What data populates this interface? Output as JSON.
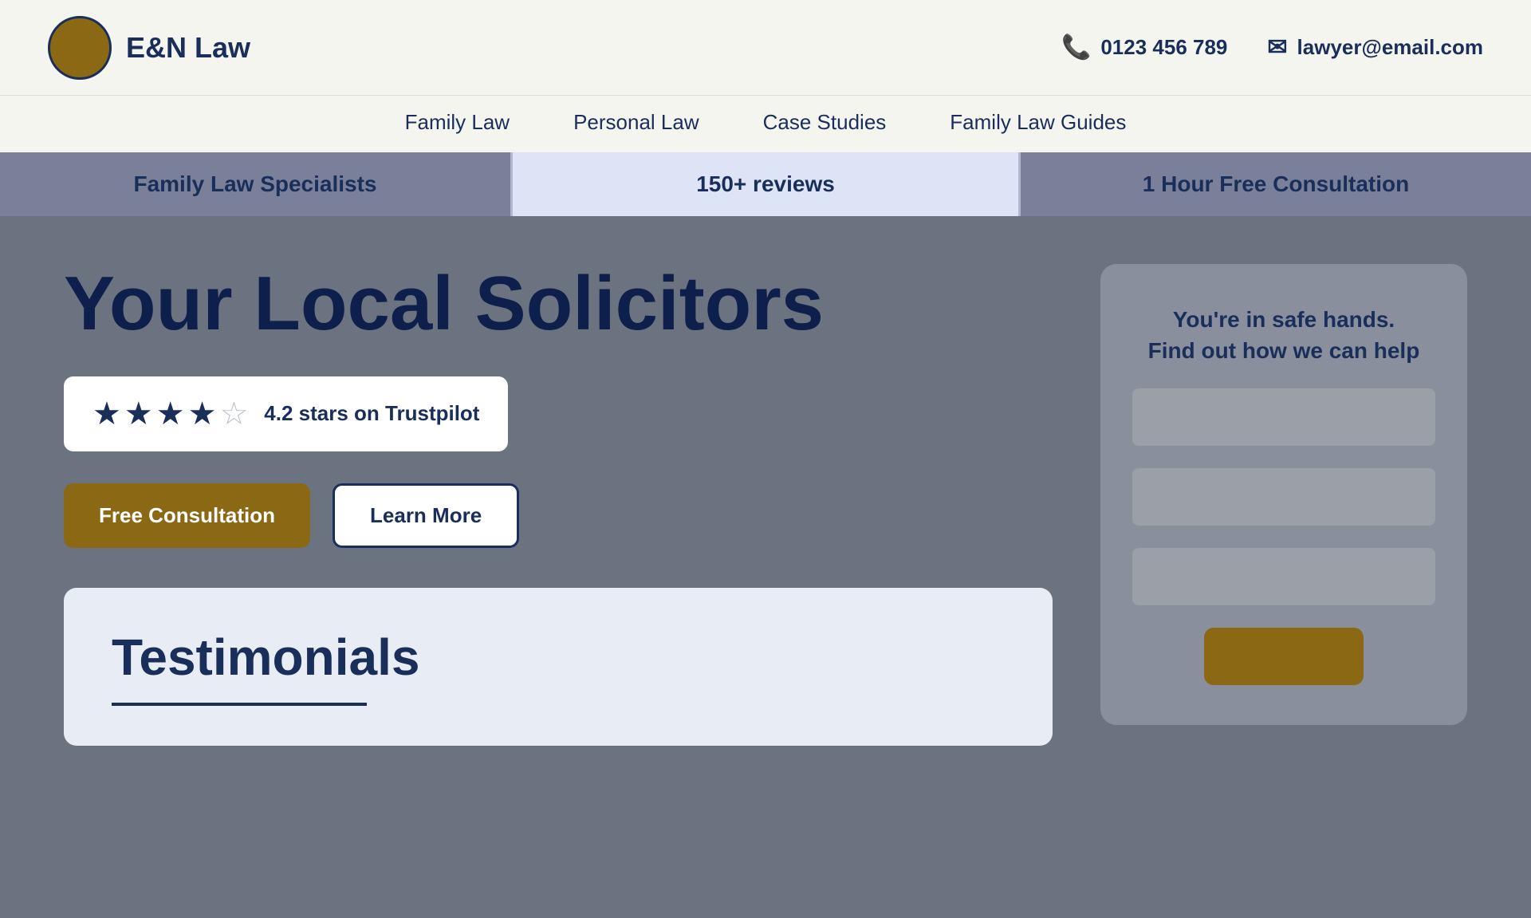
{
  "header": {
    "logo_text": "E&N Law",
    "phone": "0123 456 789",
    "email": "lawyer@email.com"
  },
  "nav": {
    "items": [
      {
        "label": "Family Law",
        "id": "family-law"
      },
      {
        "label": "Personal Law",
        "id": "personal-law"
      },
      {
        "label": "Case Studies",
        "id": "case-studies"
      },
      {
        "label": "Family Law Guides",
        "id": "family-law-guides"
      }
    ]
  },
  "banner": {
    "item1": "Family Law Specialists",
    "item2": "150+ reviews",
    "item3": "1 Hour Free Consultation"
  },
  "hero": {
    "title": "Your Local Solicitors",
    "rating_text": "4.2 stars on Trustpilot",
    "btn_primary": "Free Consultation",
    "btn_secondary": "Learn More"
  },
  "panel": {
    "title": "You're in safe hands.\nFind out how we can help",
    "field1_placeholder": "",
    "field2_placeholder": "",
    "field3_placeholder": ""
  },
  "testimonials": {
    "title": "Testimonials"
  }
}
